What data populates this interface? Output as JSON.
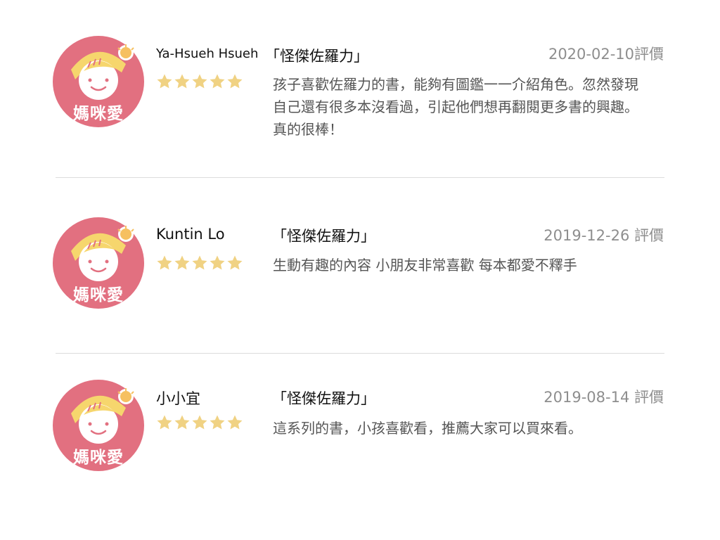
{
  "colors": {
    "avatar_bg": "#e27080",
    "hat": "#f6d66d",
    "star": "#f0d283",
    "date": "#8e8e8e",
    "text": "#555555"
  },
  "reviews": [
    {
      "avatar_icon": "mommy-love-avatar-icon",
      "avatar_text": "媽咪愛",
      "name": "Ya-Hsueh Hsueh",
      "book_title": "「怪傑佐羅力」",
      "date": "2020-02-10評價",
      "rating": 5,
      "text_lines": [
        "孩子喜歡佐羅力的書，能夠有圖鑑一一介紹角色。忽然發現",
        "自己還有很多本沒看過，引起他們想再翻閱更多書的興趣。",
        "真的很棒！"
      ]
    },
    {
      "avatar_icon": "mommy-love-avatar-icon",
      "avatar_text": "媽咪愛",
      "name": "Kuntin Lo",
      "book_title": "「怪傑佐羅力」",
      "date": "2019-12-26 評價",
      "rating": 5,
      "text_lines": [
        "生動有趣的內容 小朋友非常喜歡 每本都愛不釋手"
      ]
    },
    {
      "avatar_icon": "mommy-love-avatar-icon",
      "avatar_text": "媽咪愛",
      "name": "小小宜",
      "book_title": "「怪傑佐羅力」",
      "date": "2019-08-14 評價",
      "rating": 5,
      "text_lines": [
        "這系列的書，小孩喜歡看，推薦大家可以買來看。"
      ]
    }
  ]
}
